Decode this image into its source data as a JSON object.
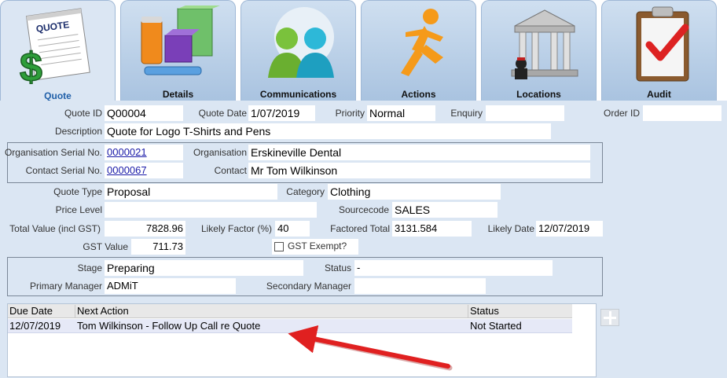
{
  "tabs": [
    {
      "label": "Quote",
      "icon": "quote-dollar-icon",
      "active": true
    },
    {
      "label": "Details",
      "icon": "product-boxes-icon"
    },
    {
      "label": "Communications",
      "icon": "people-icon"
    },
    {
      "label": "Actions",
      "icon": "running-man-icon"
    },
    {
      "label": "Locations",
      "icon": "building-icon"
    },
    {
      "label": "Audit",
      "icon": "clipboard-check-icon"
    }
  ],
  "quote_icon_text": "QUOTE",
  "form": {
    "quote_id_label": "Quote ID",
    "quote_id": "Q00004",
    "quote_date_label": "Quote Date",
    "quote_date": "1/07/2019",
    "priority_label": "Priority",
    "priority": "Normal",
    "enquiry_label": "Enquiry",
    "enquiry": "",
    "order_id_label": "Order ID",
    "order_id": "",
    "description_label": "Description",
    "description": "Quote for Logo T-Shirts and Pens",
    "org_serial_label": "Organisation Serial No.",
    "org_serial": "0000021",
    "organisation_label": "Organisation",
    "organisation": "Erskineville Dental",
    "contact_serial_label": "Contact Serial No.",
    "contact_serial": "0000067",
    "contact_label": "Contact",
    "contact": "Mr Tom Wilkinson",
    "quote_type_label": "Quote Type",
    "quote_type": "Proposal",
    "category_label": "Category",
    "category": "Clothing",
    "price_level_label": "Price Level",
    "price_level": "",
    "sourcecode_label": "Sourcecode",
    "sourcecode": "SALES",
    "total_value_label": "Total Value (incl GST)",
    "total_value": "7828.96",
    "likely_factor_label": "Likely Factor (%)",
    "likely_factor": "40",
    "factored_total_label": "Factored Total",
    "factored_total": "3131.584",
    "likely_date_label": "Likely Date",
    "likely_date": "12/07/2019",
    "gst_value_label": "GST Value",
    "gst_value": "711.73",
    "gst_exempt_label": "GST Exempt?",
    "gst_exempt_checked": false,
    "stage_label": "Stage",
    "stage": "Preparing",
    "status_label": "Status",
    "status": "-",
    "primary_manager_label": "Primary Manager",
    "primary_manager": "ADMiT",
    "secondary_manager_label": "Secondary Manager",
    "secondary_manager": ""
  },
  "actions_grid": {
    "columns": [
      "Due Date",
      "Next Action",
      "Status"
    ],
    "rows": [
      {
        "due_date": "12/07/2019",
        "next_action": "Tom Wilkinson - Follow Up Call re Quote",
        "status": "Not Started"
      }
    ]
  },
  "colors": {
    "panel_bg": "#dbe6f3",
    "tab_active_label": "#1f5fa8",
    "annotation_arrow": "#e02020"
  }
}
